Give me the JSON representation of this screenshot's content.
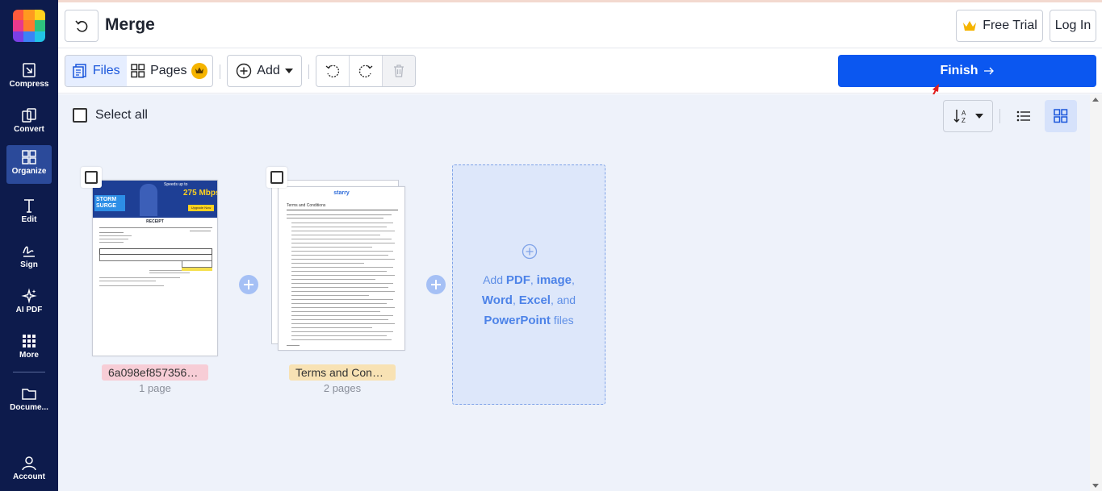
{
  "sidebar": {
    "items": [
      {
        "label": "Compress",
        "icon": "compress-icon"
      },
      {
        "label": "Convert",
        "icon": "convert-icon"
      },
      {
        "label": "Organize",
        "icon": "organize-icon",
        "active": true
      },
      {
        "label": "Edit",
        "icon": "edit-icon"
      },
      {
        "label": "Sign",
        "icon": "sign-icon"
      },
      {
        "label": "AI PDF",
        "icon": "sparkle-icon"
      },
      {
        "label": "More",
        "icon": "apps-grid-icon"
      },
      {
        "label": "Docume...",
        "icon": "folder-icon"
      }
    ],
    "account_label": "Account"
  },
  "header": {
    "title": "Merge",
    "free_trial_label": "Free Trial",
    "login_label": "Log In"
  },
  "toolbar": {
    "files_label": "Files",
    "pages_label": "Pages",
    "add_label": "Add",
    "finish_label": "Finish"
  },
  "workspace": {
    "select_all_label": "Select all",
    "files": [
      {
        "name": "6a098ef857356b2...",
        "pages": "1 page",
        "tag_color": "#f7cdd6"
      },
      {
        "name": "Terms and Condi...",
        "pages": "2 pages",
        "tag_color": "#f8e2b4"
      }
    ],
    "add_box": {
      "t1": "Add ",
      "pdf": "PDF",
      "comma1": ", ",
      "image": "image",
      "comma2": ",",
      "word": "Word",
      "comma3": ", ",
      "excel": "Excel",
      "and": ", and",
      "powerpoint": "PowerPoint",
      "files": " files"
    }
  },
  "receipt_preview": {
    "banner_small": "Speeds up to",
    "banner_big": "275 Mbps",
    "brand": "STORM SURGE",
    "cta": "Upgrade Now",
    "title": "RECEIPT"
  },
  "terms_preview": {
    "logo": "starry",
    "heading": "Terms and Conditions"
  },
  "colors": {
    "sidebar_bg": "#0d1b4c",
    "accent": "#0b57f0",
    "workspace_bg": "#eef2fa"
  }
}
